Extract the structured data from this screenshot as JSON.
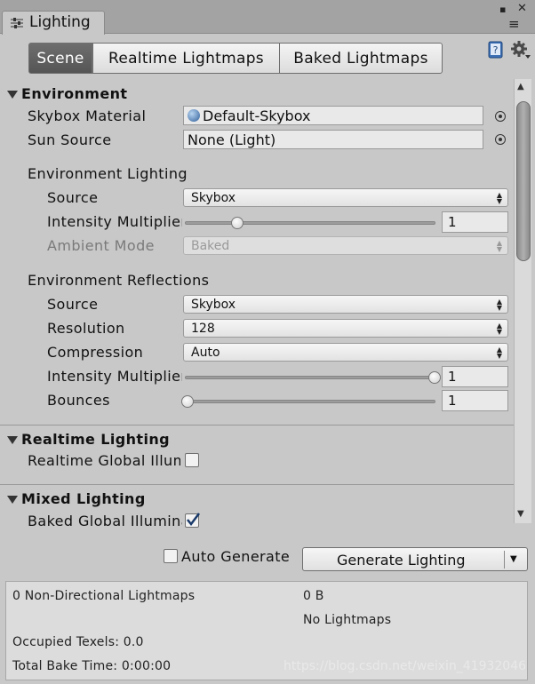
{
  "window": {
    "tab_title": "Lighting",
    "close_glyph": "▪",
    "menu_glyph": "≡"
  },
  "toolbar": {
    "tabs": [
      "Scene",
      "Realtime Lightmaps",
      "Baked Lightmaps"
    ],
    "active_tab": "Scene"
  },
  "environment": {
    "header": "Environment",
    "skybox_material": {
      "label": "Skybox Material",
      "value": "Default-Skybox"
    },
    "sun_source": {
      "label": "Sun Source",
      "value": "None (Light)"
    },
    "lighting": {
      "header": "Environment Lighting",
      "source": {
        "label": "Source",
        "value": "Skybox"
      },
      "intensity": {
        "label": "Intensity Multiplier",
        "value": "1",
        "slider_level": 0.2
      },
      "ambient_mode": {
        "label": "Ambient Mode",
        "value": "Baked"
      }
    },
    "reflections": {
      "header": "Environment Reflections",
      "source": {
        "label": "Source",
        "value": "Skybox"
      },
      "resolution": {
        "label": "Resolution",
        "value": "128"
      },
      "compression": {
        "label": "Compression",
        "value": "Auto"
      },
      "intensity": {
        "label": "Intensity Multiplier",
        "value": "1",
        "slider_level": 1.0
      },
      "bounces": {
        "label": "Bounces",
        "value": "1",
        "slider_level": 0.0
      }
    }
  },
  "realtime": {
    "header": "Realtime Lighting",
    "gi_label": "Realtime Global Illumination",
    "gi_checked": false
  },
  "mixed": {
    "header": "Mixed Lighting",
    "gi_label": "Baked Global Illumination",
    "gi_checked": true
  },
  "bottom": {
    "auto_generate_label": "Auto Generate",
    "auto_generate_checked": false,
    "generate_label": "Generate Lighting",
    "dropdown_glyph": "▼"
  },
  "stats": {
    "lightmaps": "0 Non-Directional Lightmaps",
    "size": "0 B",
    "no_lightmaps": "No Lightmaps",
    "texels": "Occupied Texels: 0.0",
    "bake_time": "Total Bake Time: 0:00:00"
  },
  "watermark": "https://blog.csdn.net/weixin_41932046",
  "icons": [
    "sliders-icon",
    "help-book-icon",
    "gear-icon",
    "object-picker-icon",
    "sphere-icon",
    "checkmark-icon"
  ],
  "colors": {
    "panel": "#c8c8c8",
    "active_tab": "#5f5f5f",
    "titlebar": "#a3a3a3"
  }
}
